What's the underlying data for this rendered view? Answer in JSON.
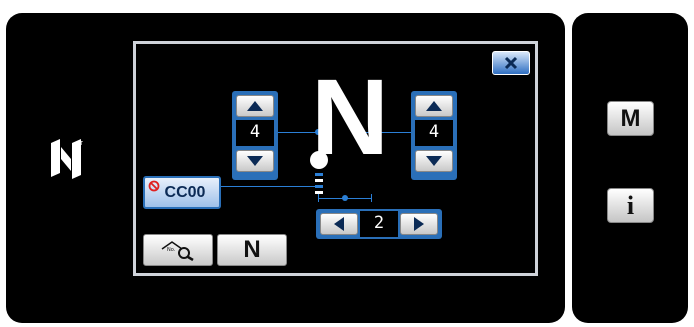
{
  "panel": {
    "close_icon": "close-icon",
    "left_top_value": "4",
    "right_top_value": "4",
    "bottom_value": "2",
    "center_letter": "N",
    "cc_button_label": "CC00",
    "search_icon": "number-search-icon",
    "n_button_label": "N",
    "nfc_icon": "nfc-logo-icon"
  },
  "side_panel": {
    "m_button_label": "M",
    "info_button_label": "i"
  },
  "colors": {
    "accent": "#2a6fb8",
    "line": "#2b7fd6",
    "background": "#000000"
  }
}
